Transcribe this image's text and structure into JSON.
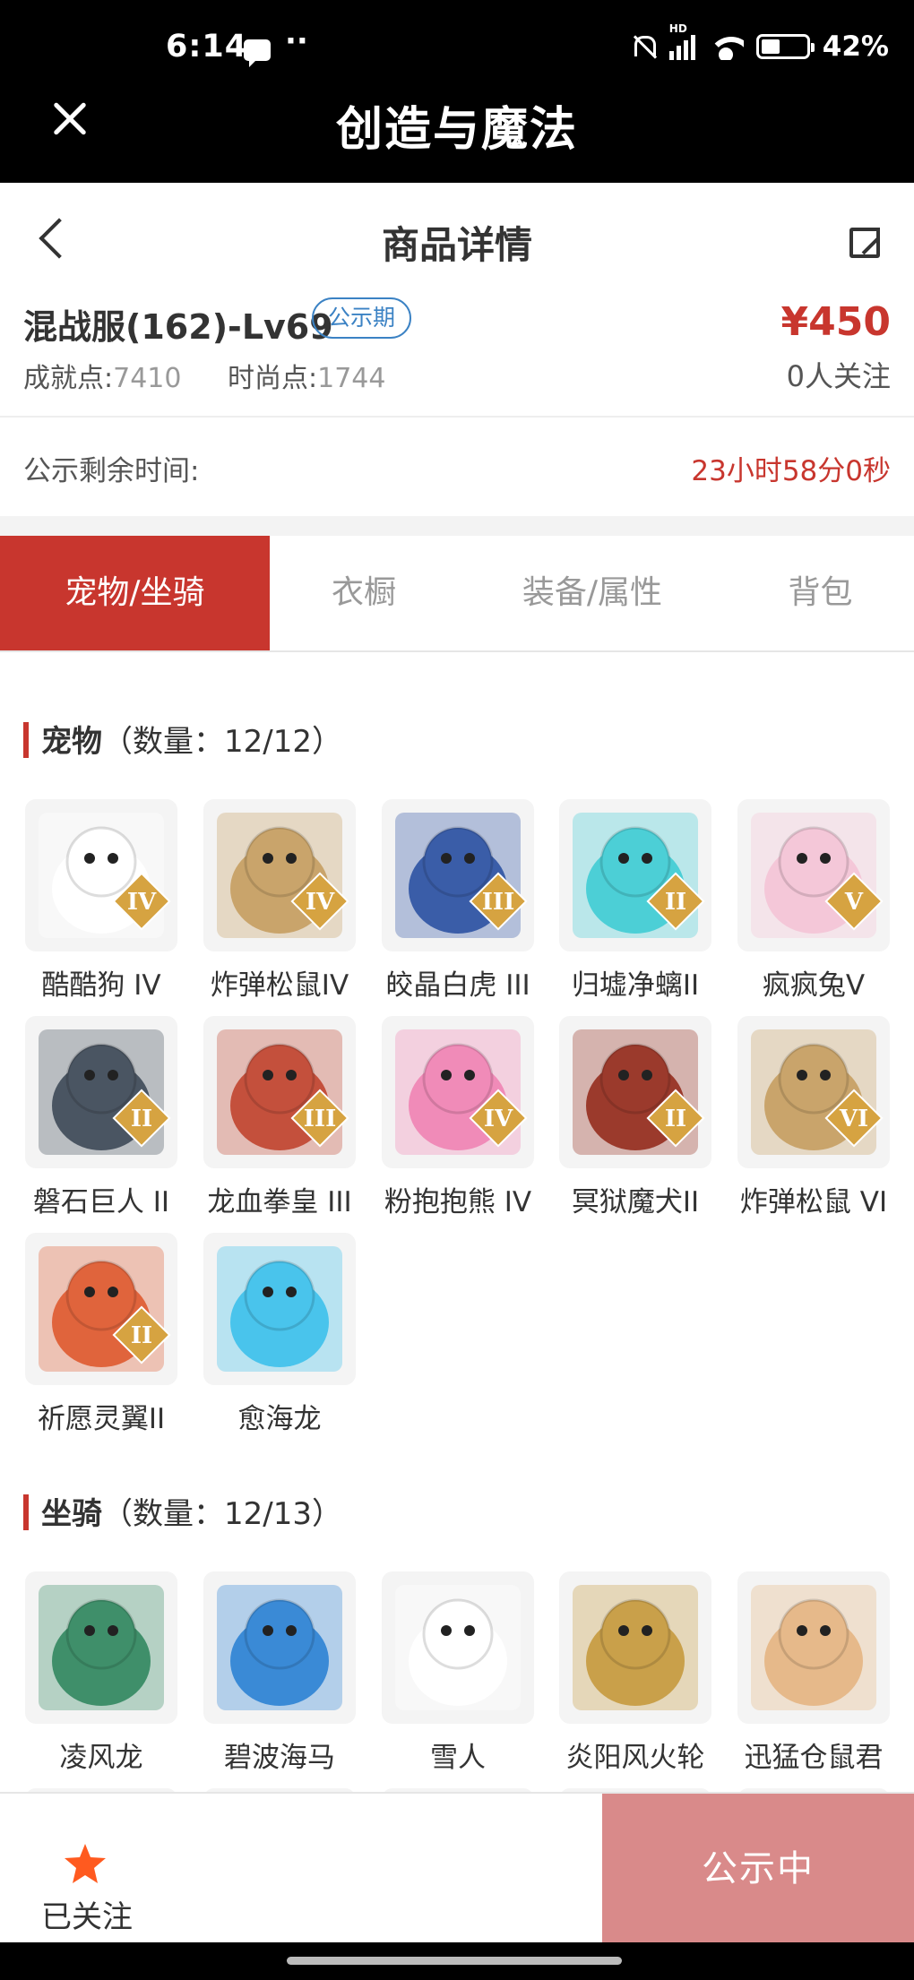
{
  "status": {
    "time": "6:14",
    "dots": "··",
    "battery": "42%",
    "network": "HD"
  },
  "app": {
    "title": "创造与魔法"
  },
  "page": {
    "title": "商品详情"
  },
  "item": {
    "name": "混战服(162)-Lv69",
    "badge": "公示期",
    "price": "¥450",
    "achievement_label": "成就点:",
    "achievement_value": "7410",
    "fashion_label": "时尚点:",
    "fashion_value": "1744",
    "followers": "0人关注"
  },
  "timer": {
    "label": "公示剩余时间:",
    "value": "23小时58分0秒"
  },
  "tabs": [
    {
      "label": "宠物/坐骑",
      "active": true
    },
    {
      "label": "衣橱",
      "active": false
    },
    {
      "label": "装备/属性",
      "active": false
    },
    {
      "label": "背包",
      "active": false
    }
  ],
  "pets": {
    "title": "宠物",
    "count": "（数量：12/12）",
    "items": [
      {
        "name": "酷酷狗 IV",
        "rank": "IV",
        "color": "#ffffff"
      },
      {
        "name": "炸弹松鼠IV",
        "rank": "IV",
        "color": "#c9a46b"
      },
      {
        "name": "皎晶白虎 III",
        "rank": "III",
        "color": "#3a5da8"
      },
      {
        "name": "归墟净螭II",
        "rank": "II",
        "color": "#4ccfd6"
      },
      {
        "name": "疯疯兔V",
        "rank": "V",
        "color": "#f4c7d8"
      },
      {
        "name": "磐石巨人 II",
        "rank": "II",
        "color": "#4a5562"
      },
      {
        "name": "龙血拳皇 III",
        "rank": "III",
        "color": "#c4503c"
      },
      {
        "name": "粉抱抱熊 IV",
        "rank": "IV",
        "color": "#f08bb8"
      },
      {
        "name": "冥狱魔犬II",
        "rank": "II",
        "color": "#9b3a2c"
      },
      {
        "name": "炸弹松鼠 VI",
        "rank": "VI",
        "color": "#c9a46b"
      },
      {
        "name": "祈愿灵翼II",
        "rank": "II",
        "color": "#e0643c"
      },
      {
        "name": "愈海龙",
        "rank": "",
        "color": "#49c4ec"
      }
    ]
  },
  "mounts": {
    "title": "坐骑",
    "count": "（数量：12/13）",
    "items": [
      {
        "name": "凌风龙",
        "color": "#3f8f6a"
      },
      {
        "name": "碧波海马",
        "color": "#3a8ad6"
      },
      {
        "name": "雪人",
        "color": "#ffffff"
      },
      {
        "name": "炎阳风火轮",
        "color": "#c9a04a"
      },
      {
        "name": "迅猛仓鼠君",
        "color": "#e6b98a"
      },
      {
        "name": "",
        "color": "#f0dcec"
      },
      {
        "name": "",
        "color": "#e9b36a"
      },
      {
        "name": "",
        "color": "#f2f2f2"
      },
      {
        "name": "",
        "color": "#5ec6e6"
      },
      {
        "name": "",
        "color": "#4a5fb8"
      },
      {
        "name": "",
        "color": "#e8ddc8"
      }
    ]
  },
  "bottom": {
    "follow_label": "已关注",
    "status_label": "公示中",
    "star_color": "#ff5a1f"
  }
}
